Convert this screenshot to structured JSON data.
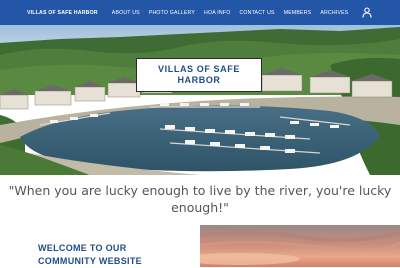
{
  "nav": {
    "brand": "VILLAS OF SAFE HARBOR",
    "items": [
      "ABOUT US",
      "PHOTO GALLERY",
      "HOA INFO",
      "CONTACT US",
      "MEMBERS",
      "ARCHIVES"
    ]
  },
  "hero": {
    "title_line1": "VILLAS OF SAFE",
    "title_line2": "HARBOR"
  },
  "quote": {
    "line1": "\"When you are lucky enough to live by the river, you're lucky",
    "line2": "enough!\""
  },
  "welcome": {
    "line1": "WELCOME TO OUR",
    "line2": "COMMUNITY WEBSITE"
  },
  "colors": {
    "nav_bg": "#2456a8",
    "heading_blue": "#1e4d8c",
    "quote_gray": "#555555"
  },
  "icons": {
    "account": "user-icon"
  }
}
